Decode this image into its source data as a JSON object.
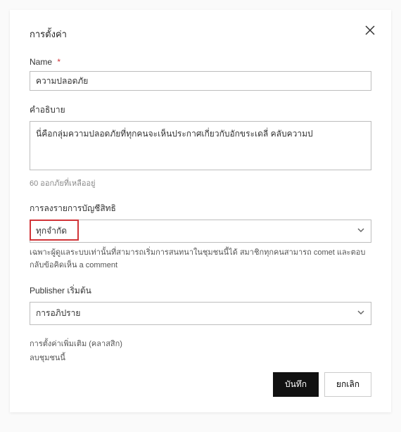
{
  "dialog": {
    "title": "การตั้งค่า",
    "name": {
      "label": "Name",
      "required": "*",
      "value": "ความปลอดภัย"
    },
    "description": {
      "label": "คำอธิบาย",
      "value": "นี่คือกลุ่มความปลอดภัยที่ทุกคนจะเห็นประกาศเกี่ยวกับอักขระเดลี่ คลับความป",
      "counter": "60 ออกภัยที่เหลืออยู่"
    },
    "posting": {
      "label": "การลงรายการบัญชีสิทธิ",
      "value": "ทุกจำกัด",
      "helper": "เฉพาะผู้ดูแลระบบเท่านั้นที่สามารถเริ่มการสนทนาในชุมชนนี้ได้ สมาชิกทุกคนสามารถ comet และตอบกลับข้อคิดเห็น a comment"
    },
    "publisher": {
      "label": "Publisher เริ่มต้น",
      "value": "การอภิปราย"
    },
    "links": {
      "more_settings": "การตั้งค่าเพิ่มเติม (คลาสสิก)",
      "delete": "ลบชุมชนนี้"
    },
    "buttons": {
      "save": "บันทึก",
      "cancel": "ยกเลิก"
    }
  }
}
